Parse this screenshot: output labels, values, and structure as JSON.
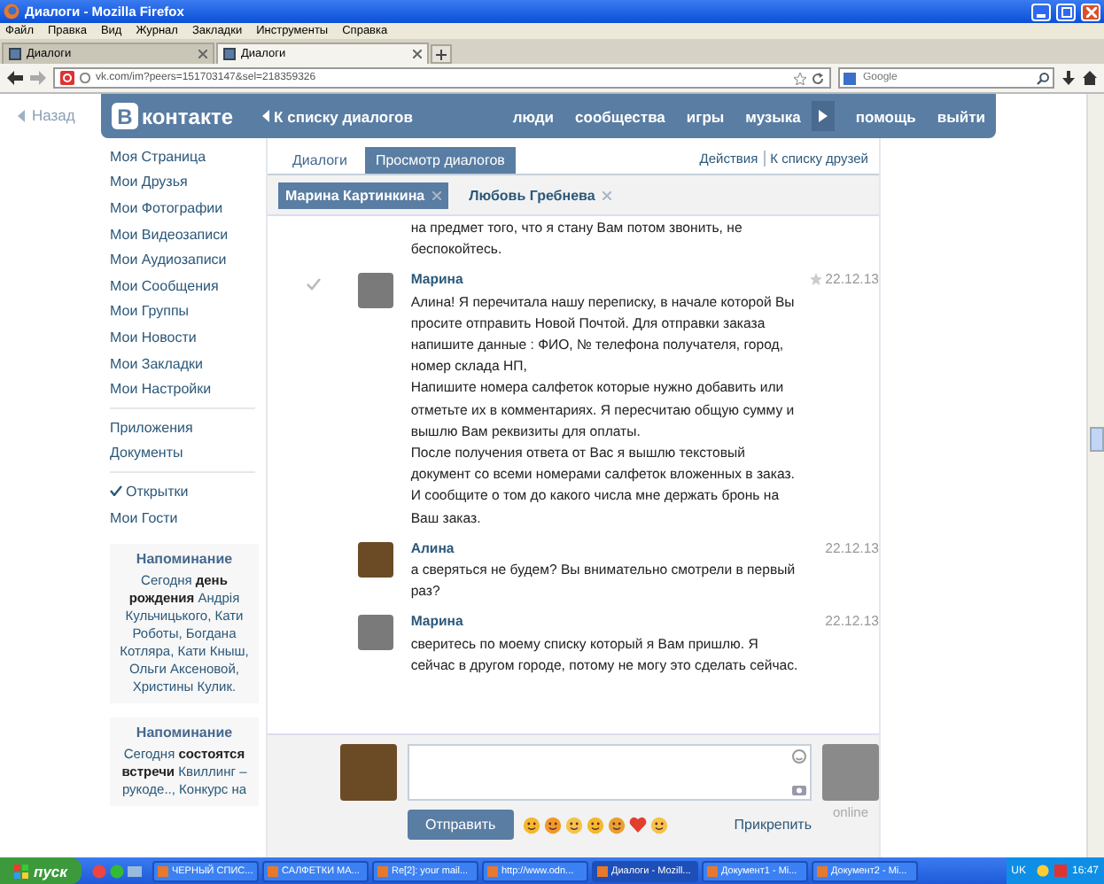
{
  "window": {
    "title": "Диалоги - Mozilla Firefox"
  },
  "menu": [
    "Файл",
    "Правка",
    "Вид",
    "Журнал",
    "Закладки",
    "Инструменты",
    "Справка"
  ],
  "tabs": [
    {
      "label": "Диалоги",
      "selected": false
    },
    {
      "label": "Диалоги",
      "selected": true
    }
  ],
  "address": {
    "value": "vk.com/im?peers=151703147&sel=218359326"
  },
  "search": {
    "placeholder": "Google"
  },
  "site": {
    "back": "Назад",
    "logo_letter": "В",
    "logo_text": "контакте",
    "breadcrumb": "К списку диалогов",
    "nav": [
      "люди",
      "сообщества",
      "игры",
      "музыка"
    ],
    "nav_more": [
      "помощь",
      "выйти"
    ]
  },
  "sidebar": {
    "groups": [
      [
        {
          "label": "Моя Страница",
          "checked": false
        },
        {
          "label": "Мои Друзья",
          "checked": false
        },
        {
          "label": "Мои Фотографии",
          "checked": false
        },
        {
          "label": "Мои Видеозаписи",
          "checked": false
        },
        {
          "label": "Мои Аудиозаписи",
          "checked": false
        },
        {
          "label": "Мои Сообщения",
          "checked": false
        },
        {
          "label": "Мои Группы",
          "checked": false
        },
        {
          "label": "Мои Новости",
          "checked": false
        },
        {
          "label": "Мои Закладки",
          "checked": false
        },
        {
          "label": "Мои Настройки",
          "checked": false
        }
      ],
      [
        {
          "label": "Приложения",
          "checked": false
        },
        {
          "label": "Документы",
          "checked": false
        }
      ],
      [
        {
          "label": "Открытки",
          "checked": true
        },
        {
          "label": "Мои Гости",
          "checked": false
        }
      ]
    ]
  },
  "reminders": [
    {
      "title": "Напоминание",
      "text": "Сегодня **день рождения** Андрія Кульчицького, Кати Роботы, Богдана Котляра, Кати Кныш, Ольги Аксеновой, Христины Кулик."
    },
    {
      "title": "Напоминание",
      "text": "Сегодня **состоятся встречи** Квиллинг – рукоде.., Конкурс на"
    }
  ],
  "dialog": {
    "tabs": [
      {
        "label": "Диалоги",
        "selected": false
      },
      {
        "label": "Просмотр диалогов",
        "selected": true
      }
    ],
    "actions": [
      "Действия",
      "К списку друзей"
    ],
    "peers": [
      {
        "name": "Марина Картинкина",
        "selected": true
      },
      {
        "name": "Любовь Гребнева",
        "selected": false
      }
    ],
    "messages": [
      {
        "kind": "continuation",
        "paragraphs": [
          "на предмет того, что я стану Вам потом звонить, не беспокойтесь."
        ]
      },
      {
        "kind": "message",
        "author": "Марина",
        "date": "22.12.13",
        "checked": true,
        "starred": true,
        "color": "#7a7a7a",
        "paragraphs": [
          "Алина! Я перечитала нашу переписку, в начале которой Вы просите отправить Новой Почтой. Для отправки заказа напишите данные : ФИО, № телефона получателя, город, номер склада НП,",
          "Напишите номера салфеток которые нужно добавить или отметьте их в комментариях. Я пересчитаю общую сумму и вышлю Вам реквизиты для оплаты.",
          "После получения ответа от Вас я вышлю текстовый документ со всеми номерами салфеток вложенных в заказ.",
          "И сообщите о том до какого числа мне держать бронь на Ваш заказ."
        ]
      },
      {
        "kind": "message",
        "author": "Алина",
        "date": "22.12.13",
        "checked": false,
        "starred": false,
        "color": "#6b4a26",
        "paragraphs": [
          "а сверяться не будем? Вы внимательно смотрели в первый раз?"
        ]
      },
      {
        "kind": "message",
        "author": "Марина",
        "date": "22.12.13",
        "checked": false,
        "starred": false,
        "color": "#7a7a7a",
        "paragraphs": [
          "сверитесь по моему списку который я Вам пришлю. Я сейчас в другом городе, потому не могу это сделать сейчас."
        ]
      }
    ],
    "composer": {
      "own_avatar": {
        "color": "#6b4a26"
      },
      "peer_avatar": {
        "color": "#8a8a8a"
      },
      "send": "Отправить",
      "attach": "Прикрепить",
      "status": "online"
    }
  },
  "taskbar": {
    "start": "пуск",
    "items": [
      {
        "label": "ЧЕРНЫЙ СПИС...",
        "selected": false
      },
      {
        "label": "САЛФЕТКИ МА...",
        "selected": false
      },
      {
        "label": "Re[2]: your mail...",
        "selected": false
      },
      {
        "label": "http://www.odn...",
        "selected": false
      },
      {
        "label": "Диалоги - Mozill...",
        "selected": true
      },
      {
        "label": "Документ1 - Mi...",
        "selected": false
      },
      {
        "label": "Документ2 - Mi...",
        "selected": false
      }
    ],
    "lang": "UK",
    "time": "16:47"
  }
}
